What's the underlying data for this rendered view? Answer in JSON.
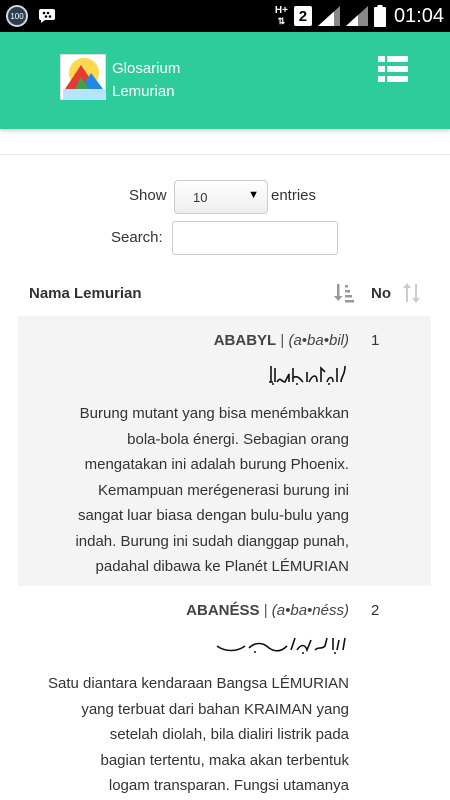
{
  "status_bar": {
    "notification_badge": "100",
    "network_type": "H+",
    "sim_slot": "2",
    "time": "01:04"
  },
  "app": {
    "title_line1": "Glosarium",
    "title_line2": "Lemurian",
    "accent_color": "#2ecc9a",
    "menu_icon": "list-icon"
  },
  "controls": {
    "show_label": "Show",
    "entries_value": "10",
    "entries_label": "entries",
    "search_label": "Search:",
    "search_value": ""
  },
  "table": {
    "columns": [
      "Nama Lemurian",
      "No"
    ],
    "rows": [
      {
        "term": "ABABYL",
        "separator": "|",
        "pronunciation": "(a•ba•bil)",
        "description_lines": [
          "Burung mutant yang bisa menémbakkan",
          "bola-bola énergi. Sebagian orang",
          "mengatakan ini adalah burung Phoenix.",
          "Kemampuan merégenerasi burung ini",
          "sangat luar biasa dengan bulu-bulu yang",
          "indah. Burung ini sudah dianggap punah,",
          "padahal dibawa ke Planét LÉMURIAN"
        ],
        "no": "1"
      },
      {
        "term": "ABANÉSS",
        "separator": "|",
        "pronunciation": "(a•ba•néss)",
        "description_lines": [
          "Satu diantara kendaraan Bangsa LÉMURIAN",
          "yang terbuat dari bahan KRAIMAN yang",
          "setelah diolah, bila dialiri listrik pada",
          "bagian tertentu, maka akan terbentuk",
          "logam transparan. Fungsi utamanya"
        ],
        "no": "2"
      }
    ]
  }
}
